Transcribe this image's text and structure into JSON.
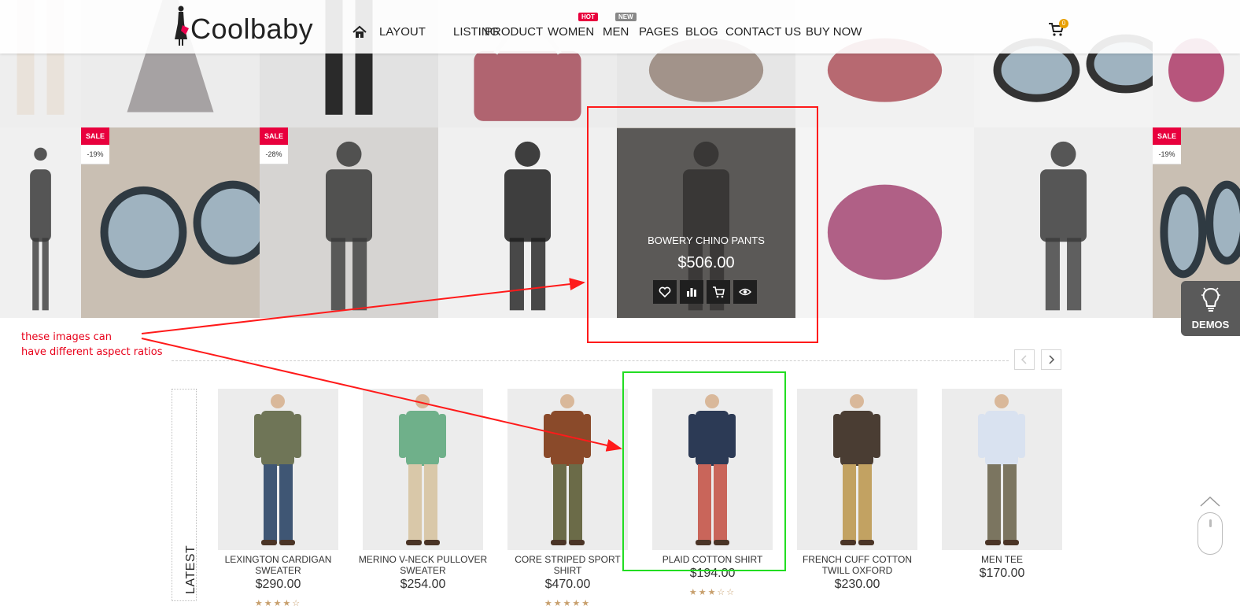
{
  "header": {
    "logo_text": "Coolbaby",
    "nav": [
      {
        "label": "LAYOUT"
      },
      {
        "label": "LISTING"
      },
      {
        "label": "PRODUCT"
      },
      {
        "label": "WOMEN",
        "tag": "HOT",
        "tag_color": "#e8003d"
      },
      {
        "label": "MEN",
        "tag": "NEW",
        "tag_color": "#888888"
      },
      {
        "label": "PAGES"
      },
      {
        "label": "BLOG"
      },
      {
        "label": "CONTACT US"
      },
      {
        "label": "BUY NOW"
      }
    ],
    "cart_count": "0",
    "cart_badge_color": "#e8a000"
  },
  "gallery": {
    "tiles": [
      {
        "kind": "model-white-legs"
      },
      {
        "kind": "grey-gown"
      },
      {
        "kind": "black-dress-legs"
      },
      {
        "kind": "pink-handbag"
      },
      {
        "kind": "glitter-shoe"
      },
      {
        "kind": "jeweled-heel"
      },
      {
        "kind": "sunglasses"
      },
      {
        "kind": "pink-heel-partial"
      },
      {
        "kind": "jacket-partial"
      },
      {
        "kind": "sunglasses-closeup",
        "sale": "SALE",
        "discount": "-19%"
      },
      {
        "kind": "scarf-model",
        "sale": "SALE",
        "discount": "-28%"
      },
      {
        "kind": "suit-model"
      },
      {
        "kind": "hovered-couple"
      },
      {
        "kind": "pink-pumps"
      },
      {
        "kind": "jacket-model"
      },
      {
        "kind": "sunglasses-partial",
        "sale": "SALE",
        "discount": "-19%"
      }
    ],
    "hover": {
      "name": "BOWERY CHINO PANTS",
      "price": "$506.00",
      "actions": [
        "heart-icon",
        "compare-icon",
        "cart-icon",
        "eye-icon"
      ]
    }
  },
  "demos": {
    "label": "DEMOS"
  },
  "annotation": {
    "line1": "these images can",
    "line2": "have different aspect ratios",
    "color": "#e8001a"
  },
  "latest": {
    "label": "LATEST",
    "products": [
      {
        "name": "LEXINGTON CARDIGAN SWEATER",
        "price": "$290.00",
        "rating": 4,
        "jacket": "#6f7557",
        "pants": "#3f5674"
      },
      {
        "name": "MERINO V-NECK PULLOVER SWEATER",
        "price": "$254.00",
        "rating": 0,
        "jacket": "#6fb08a",
        "pants": "#d9c8a9"
      },
      {
        "name": "CORE STRIPED SPORT SHIRT",
        "price": "$470.00",
        "rating": 5,
        "jacket": "#8a4a2a",
        "pants": "#6b6b48"
      },
      {
        "name": "PLAID COTTON SHIRT",
        "price": "$194.00",
        "rating": 3,
        "jacket": "#2c3a55",
        "pants": "#c9655a"
      },
      {
        "name": "FRENCH CUFF COTTON TWILL OXFORD",
        "price": "$230.00",
        "rating": 0,
        "jacket": "#4a3d33",
        "pants": "#c2a262"
      },
      {
        "name": "MEN TEE",
        "price": "$170.00",
        "rating": 0,
        "jacket": "#d9e2f0",
        "pants": "#7b7560"
      }
    ]
  }
}
